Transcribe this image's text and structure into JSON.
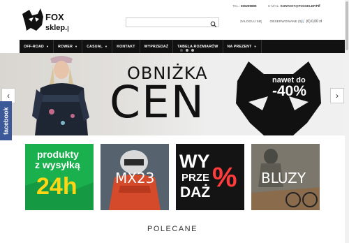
{
  "header": {
    "phone_label": "TEL.:",
    "phone_value": "500299899",
    "email_label": "E-MAIL:",
    "email_value": "KONTAKT@FOXSKLEP.PL",
    "language": "▾",
    "logo_text_1": "FOX",
    "logo_text_2": "sklep.pl"
  },
  "search": {
    "placeholder": "",
    "value": ""
  },
  "account": {
    "login": "ZALOGUJ SIĘ",
    "wishlist": "OBSERWOWANE (0)",
    "cart": "(0) 0,00 zł"
  },
  "nav": {
    "items": [
      {
        "label": "OFF-ROAD",
        "dropdown": true
      },
      {
        "label": "ROWER",
        "dropdown": true
      },
      {
        "label": "CASUAL",
        "dropdown": true
      },
      {
        "label": "KONTAKT",
        "dropdown": false
      },
      {
        "label": "WYPRZEDAŻ",
        "dropdown": false
      },
      {
        "label": "TABELA ROZMIARÓW",
        "dropdown": false
      },
      {
        "label": "NA PREZENT",
        "dropdown": true
      }
    ]
  },
  "hero": {
    "headline_1": "OBNIŻKA",
    "headline_2": "CEN",
    "badge_top": "nawet do",
    "badge_value": "-40%",
    "arrow_left": "‹",
    "arrow_right": "›",
    "slide_count": 3,
    "active_slide": 1
  },
  "facebook_tab": "facebook",
  "tiles": [
    {
      "line_1": "produkty",
      "line_2": "z wysyłką",
      "line_3": "24h"
    },
    {
      "line_1": "MX23"
    },
    {
      "line_1": "WY",
      "line_2": "PRZE",
      "line_3": "DAŻ",
      "accent": "%"
    },
    {
      "line_1": "BLUZY"
    }
  ],
  "section_title": "POLECANE",
  "colors": {
    "nav_bg": "#111111",
    "tile_green": "#19b34d",
    "accent_yellow": "#ffd514",
    "sale_red": "#ff3b3b",
    "facebook_blue": "#3b5998"
  }
}
